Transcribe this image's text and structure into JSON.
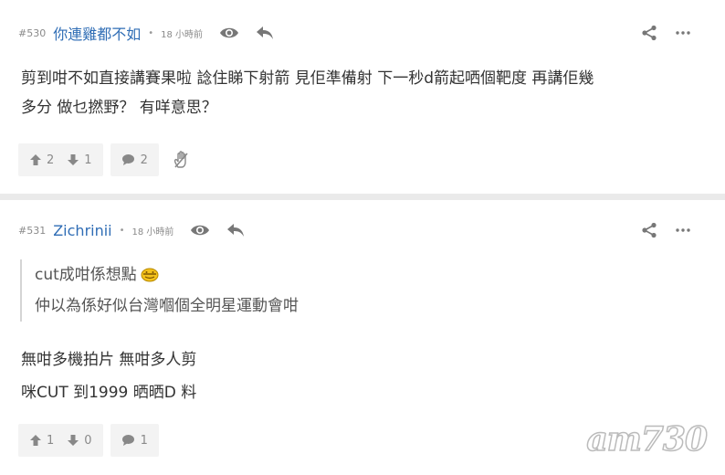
{
  "posts": [
    {
      "number": "#530",
      "username": "你連雞都不如",
      "username_color": "#2f6db5",
      "time": "18 小時前",
      "content_lines": [
        "剪到咁不如直接講賽果啦 諗住睇下射箭 見佢準備射 下一秒d箭起哂個靶度 再講佢幾",
        "多分 做乜撚野？ 有咩意思？"
      ],
      "upvotes": "2",
      "downvotes": "1",
      "comments": "2"
    },
    {
      "number": "#531",
      "username": "Zichrinii",
      "username_color": "#2f6db5",
      "time": "18 小時前",
      "quote_lines": [
        "cut成咁係想點",
        "仲以為係好似台灣嗰個全明星運動會咁"
      ],
      "content_lines": [
        "無咁多機拍片 無咁多人剪",
        "咪CUT 到1999 晒晒D 料"
      ],
      "upvotes": "1",
      "downvotes": "0",
      "comments": "1"
    }
  ],
  "separator": "•",
  "watermark": "am730"
}
